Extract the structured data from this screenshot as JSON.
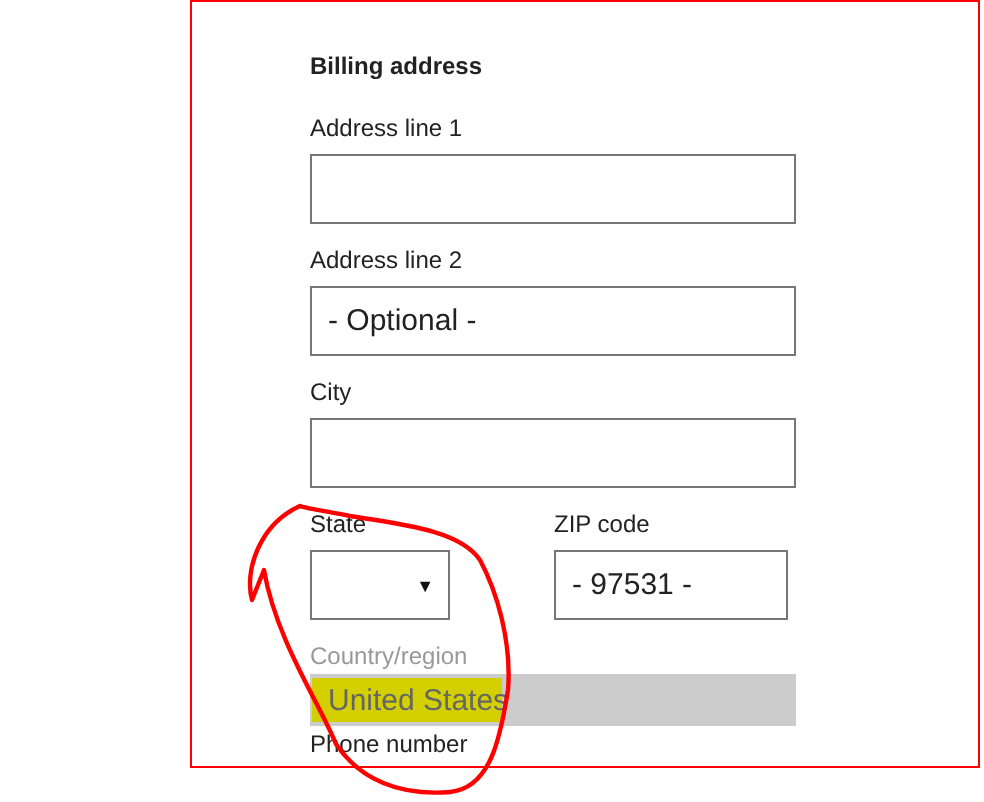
{
  "heading": "Billing address",
  "fields": [
    {
      "kind": "text",
      "label": "Address line 1"
    },
    {
      "kind": "text",
      "label": "Address line 2",
      "placeholder": "- Optional -"
    },
    {
      "kind": "text",
      "label": "City"
    }
  ],
  "state_zip": [
    {
      "kind": "select",
      "label": "State",
      "arrow": "▼"
    },
    {
      "kind": "text",
      "label": "ZIP code",
      "placeholder": "- 97531 -"
    }
  ],
  "country": {
    "label": "Country/region",
    "value": "United States",
    "disabled": true
  },
  "phone": {
    "label": "Phone number"
  },
  "annotations": [
    {
      "kind": "highlight",
      "color": "#d4d000"
    },
    {
      "kind": "circle",
      "color": "#ff0000"
    }
  ]
}
